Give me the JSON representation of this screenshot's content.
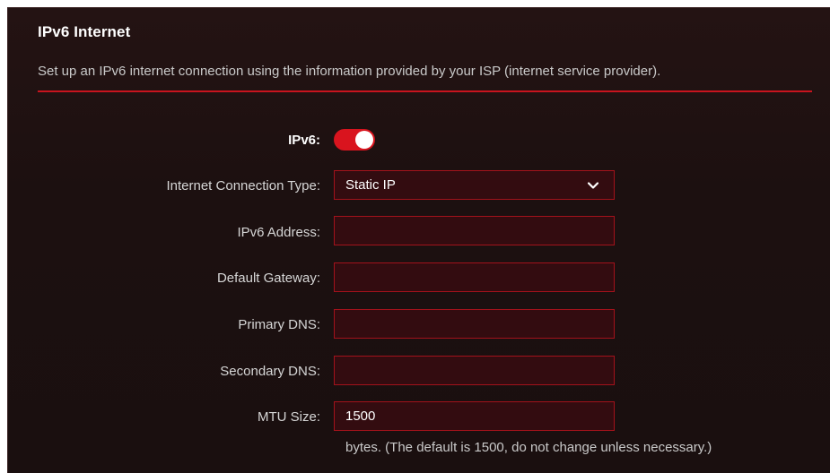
{
  "section": {
    "title": "IPv6 Internet",
    "description": "Set up an IPv6 internet connection using the information provided by your ISP (internet service provider)."
  },
  "ipv6": {
    "label": "IPv6:",
    "enabled": true
  },
  "connection_type": {
    "label": "Internet Connection Type:",
    "value": "Static IP"
  },
  "ipv6_address": {
    "label": "IPv6 Address:",
    "value": ""
  },
  "default_gateway": {
    "label": "Default Gateway:",
    "value": ""
  },
  "primary_dns": {
    "label": "Primary DNS:",
    "value": ""
  },
  "secondary_dns": {
    "label": "Secondary DNS:",
    "value": ""
  },
  "mtu": {
    "label": "MTU Size:",
    "value": "1500",
    "hint": "bytes. (The default is 1500, do not change unless necessary.)"
  },
  "colors": {
    "accent": "#d9141e",
    "panel_bg": "#1c1010",
    "field_bg": "#330c10",
    "field_border": "#a3121b"
  }
}
